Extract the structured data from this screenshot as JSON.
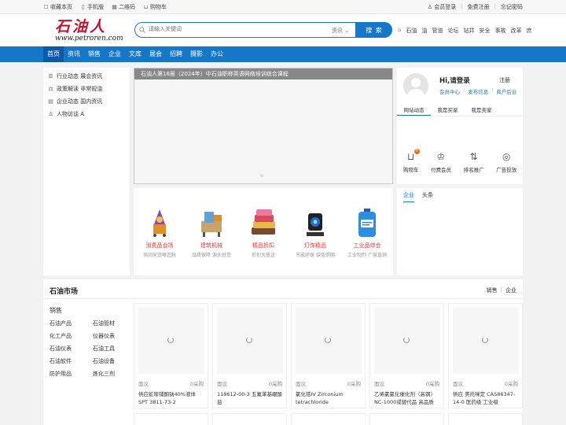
{
  "topbar": {
    "left": [
      "收藏本页",
      "手机版",
      "二维码",
      "购物车"
    ],
    "right": [
      "会员登录",
      "免费注册",
      "忘记密码"
    ]
  },
  "logo": {
    "cn": "石油人",
    "en": "www.petroren.com"
  },
  "search": {
    "placeholder": "请输入关键词",
    "category": "资讯",
    "button": "搜 索"
  },
  "hot_links": [
    "石油",
    "油",
    "管道",
    "论坛",
    "钻井",
    "安全",
    "事故",
    "改革",
    "庶"
  ],
  "nav": [
    "首页",
    "资讯",
    "销售",
    "企业",
    "文库",
    "展会",
    "招聘",
    "摄影",
    "办公"
  ],
  "categories": [
    "行业动态 展会资讯",
    "政策解读 非常规油",
    "企业动态 国内资讯",
    "人物访谈 A"
  ],
  "banner": {
    "caption": "石油人第16届（2024年）中石油职称英语网络培训综合课程"
  },
  "user": {
    "greeting": "Hi,请登录",
    "register": "注册",
    "links": [
      "会员中心",
      "发布信息",
      "商户后台"
    ],
    "tabs": [
      "网站动态",
      "我是买家",
      "我是卖家"
    ],
    "quick": [
      "购物车",
      "付费会员",
      "排名推广",
      "广告投放"
    ],
    "cart_count": "0"
  },
  "promo": [
    {
      "title": "消费品会场",
      "sub": "供间采货嘛您抢"
    },
    {
      "title": "建筑机械",
      "sub": "品质保障 源头好货"
    },
    {
      "title": "精品折扣",
      "sub": "折扣大放送"
    },
    {
      "title": "灯饰精品",
      "sub": "节能环保 绿色照明"
    },
    {
      "title": "工业品综合",
      "sub": "工业制剂 厂家直销"
    }
  ],
  "news_tabs": [
    "企业",
    "头条"
  ],
  "market": {
    "title": "石油市场",
    "right": [
      "销售",
      "企业"
    ],
    "cat_head": "销售",
    "cats": [
      "石油产品",
      "石油管材",
      "化工产品",
      "仪器仪表",
      "石油仪表",
      "石油工具",
      "石油软件",
      "石油设备",
      "防护用品",
      "炼化三剂"
    ],
    "products": [
      {
        "price": "面议",
        "sales": "0采购",
        "name": "供应蛇喹铺酮钠40%液体 SPT 3811-73-2"
      },
      {
        "price": "面议",
        "sales": "0采购",
        "name": "118612-00-3 五氟苯基硼酸盐"
      },
      {
        "price": "面议",
        "sales": "0采购",
        "name": "氯化锆IV Zirconium tetrachloride"
      },
      {
        "price": "面议",
        "sales": "0采购",
        "name": "乙烯氯氯化催化剂（高钢）NC-1000或替代品 高品质"
      },
      {
        "price": "面议",
        "sales": "0采购",
        "name": "供应 美托咪定 CAS86347-14-0 医药级 工业级"
      }
    ]
  }
}
